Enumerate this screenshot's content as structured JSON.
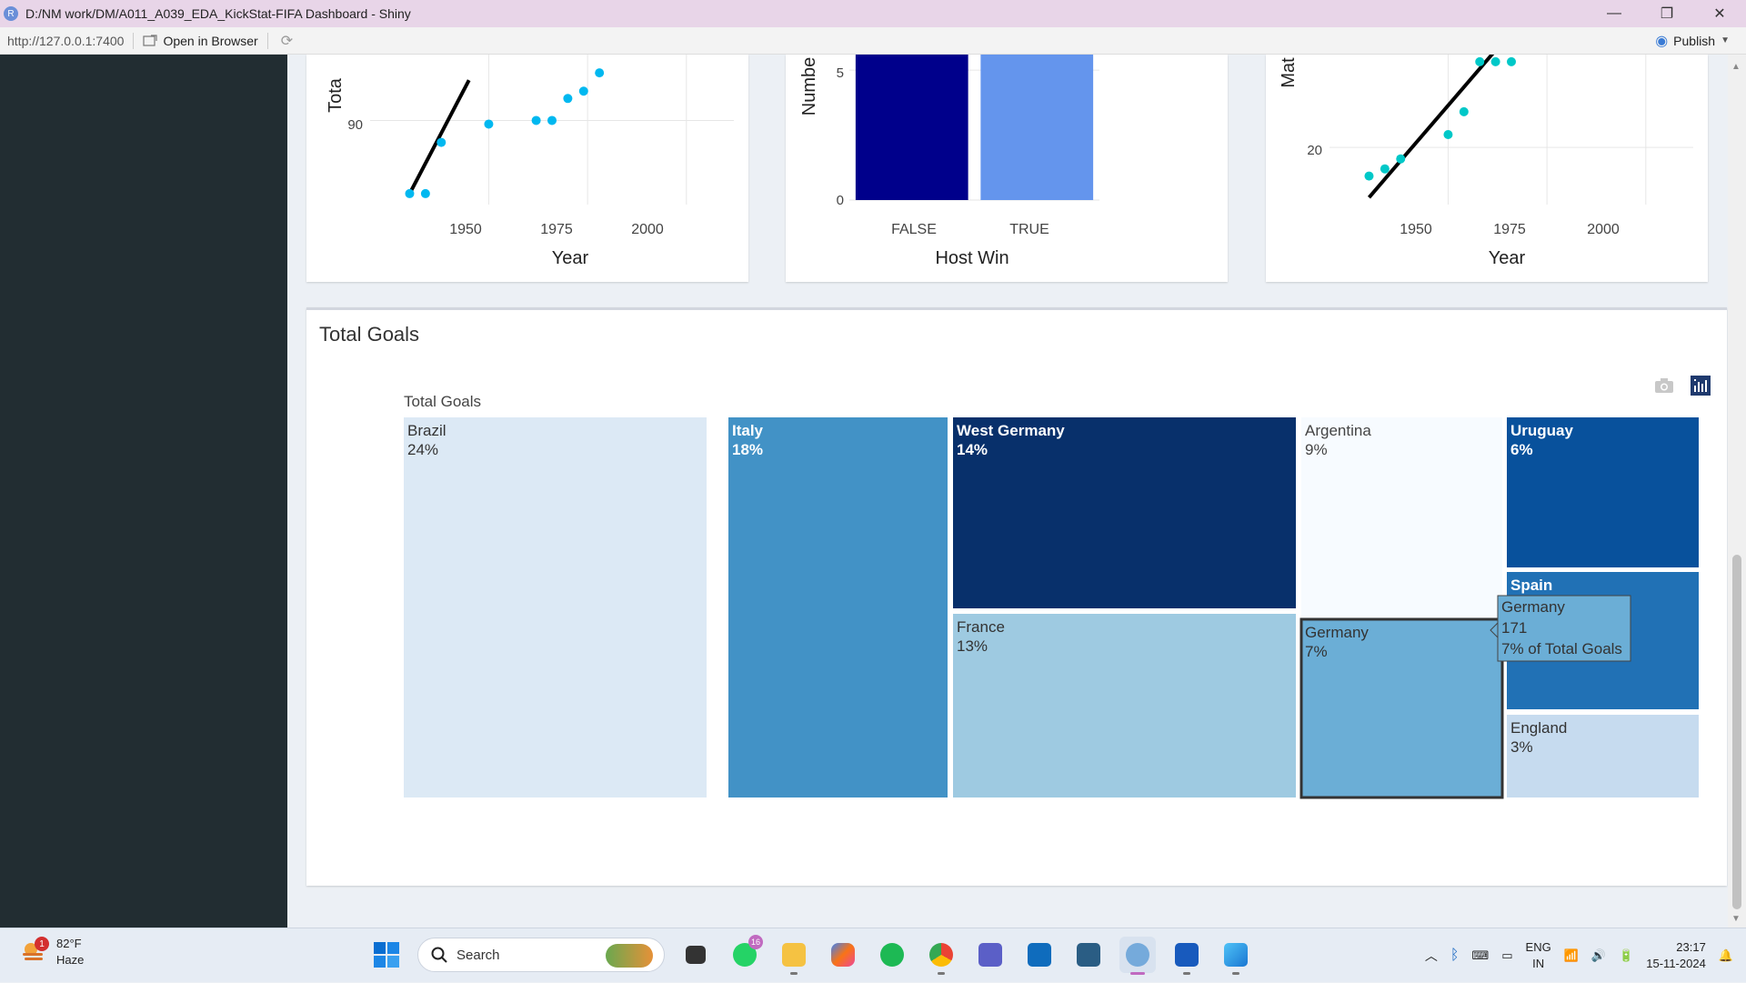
{
  "window": {
    "title": "D:/NM work/DM/A011_A039_EDA_KickStat-FIFA Dashboard - Shiny",
    "app_icon_letter": "R",
    "minimize": "—",
    "maximize": "❐",
    "close": "✕"
  },
  "addressbar": {
    "url": "http://127.0.0.1:7400",
    "open_in_browser": "Open in Browser",
    "publish": "Publish"
  },
  "charts_top": {
    "left": {
      "ylabel": "Tota",
      "xlabel": "Year",
      "ytick": "90",
      "xticks": [
        "1950",
        "1975",
        "2000"
      ]
    },
    "middle": {
      "ylabel": "Numbe",
      "xlabel": "Host Win",
      "yticks": [
        "5",
        "0"
      ],
      "categories": [
        "FALSE",
        "TRUE"
      ]
    },
    "right": {
      "ylabel": "Mat",
      "xlabel": "Year",
      "ytick": "20",
      "xticks": [
        "1950",
        "1975",
        "2000"
      ]
    }
  },
  "treemap_box": {
    "title": "Total Goals"
  },
  "chart_data": [
    {
      "type": "scatter",
      "xlabel": "Year",
      "ylabel": "Tota",
      "x": [
        1930,
        1934,
        1938,
        1950,
        1962,
        1966,
        1970,
        1974,
        1978
      ],
      "y": [
        70,
        70,
        84,
        89,
        90,
        90,
        96,
        98,
        103
      ],
      "trend_line": {
        "x": [
          1930,
          1945
        ],
        "y": [
          70,
          101
        ]
      },
      "xlim": [
        1920,
        2012
      ],
      "ylim": [
        67,
        108
      ],
      "color": "#00b8f0"
    },
    {
      "type": "bar",
      "xlabel": "Host Win",
      "ylabel": "Numbe",
      "categories": [
        "FALSE",
        "TRUE"
      ],
      "values": [
        5.6,
        5.6
      ],
      "ylim": [
        0,
        5.6
      ],
      "colors": [
        "#00008b",
        "#6495ed"
      ]
    },
    {
      "type": "scatter",
      "xlabel": "Year",
      "ylabel": "Mat",
      "x": [
        1930,
        1934,
        1938,
        1950,
        1954,
        1958,
        1962,
        1966
      ],
      "y": [
        18,
        18.5,
        19.2,
        20.9,
        22.5,
        26,
        26,
        26
      ],
      "trend_line": {
        "x": [
          1930,
          1962
        ],
        "y": [
          16.5,
          26.8
        ]
      },
      "xlim": [
        1920,
        2012
      ],
      "ylim": [
        16,
        26.5
      ],
      "color": "#00c8c8"
    },
    {
      "type": "treemap",
      "title": "Total Goals",
      "nodes": [
        {
          "name": "Brazil",
          "percent": "24%",
          "color": "#dce9f5",
          "text_color": "#333333"
        },
        {
          "name": "Italy",
          "percent": "18%",
          "color": "#4292c6",
          "text_color": "#ffffff"
        },
        {
          "name": "West Germany",
          "percent": "14%",
          "color": "#08306b",
          "text_color": "#ffffff"
        },
        {
          "name": "France",
          "percent": "13%",
          "color": "#9ecae1",
          "text_color": "#333333"
        },
        {
          "name": "Argentina",
          "percent": "9%",
          "color": "#f7fbff",
          "text_color": "#444444"
        },
        {
          "name": "Germany",
          "percent": "7%",
          "color": "#6baed6",
          "text_color": "#333333"
        },
        {
          "name": "Uruguay",
          "percent": "6%",
          "color": "#08519c",
          "text_color": "#ffffff"
        },
        {
          "name": "Spain",
          "percent": "6%",
          "color": "#2171b5",
          "text_color": "#ffffff"
        },
        {
          "name": "England",
          "percent": "3%",
          "color": "#c6dbef",
          "text_color": "#333333"
        }
      ],
      "hover": {
        "name": "Germany",
        "value": "171",
        "label": "7% of Total Goals"
      }
    }
  ],
  "taskbar": {
    "temp": "82°F",
    "weather": "Haze",
    "weather_badge": "1",
    "search_placeholder": "Search",
    "whatsapp_badge": "16",
    "lang_top": "ENG",
    "lang_bottom": "IN",
    "time": "23:17",
    "date": "15-11-2024"
  }
}
